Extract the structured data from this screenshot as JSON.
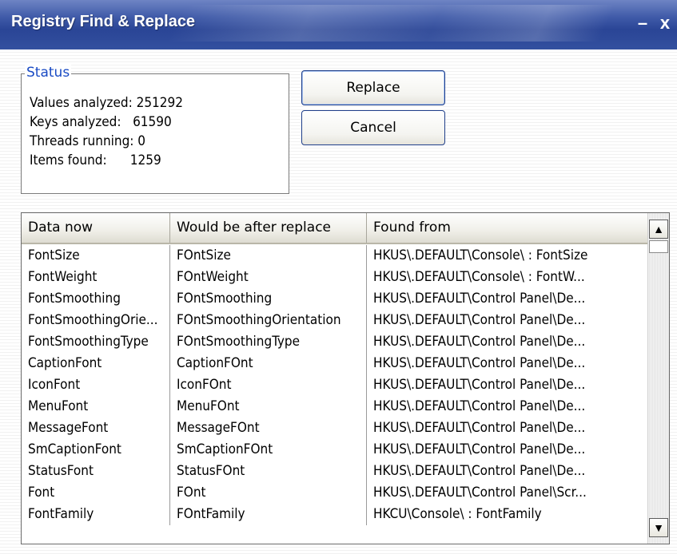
{
  "window": {
    "title": "Registry Find & Replace",
    "minimize_glyph": "–",
    "close_glyph": "x"
  },
  "status": {
    "legend": "Status",
    "values_analyzed": "Values analyzed: 251292",
    "keys_analyzed": "Keys analyzed:   61590",
    "threads_running": "Threads running: 0",
    "items_found": "Items found:      1259"
  },
  "buttons": {
    "replace": "Replace",
    "cancel": "Cancel"
  },
  "table": {
    "columns": [
      "Data now",
      "Would be after replace",
      "Found from"
    ],
    "rows": [
      [
        "FontSize",
        "FOntSize",
        "HKUS\\.DEFAULT\\Console\\ : FontSize"
      ],
      [
        "FontWeight",
        "FOntWeight",
        "HKUS\\.DEFAULT\\Console\\ : FontW..."
      ],
      [
        "FontSmoothing",
        "FOntSmoothing",
        "HKUS\\.DEFAULT\\Control Panel\\De..."
      ],
      [
        "FontSmoothingOrie...",
        "FOntSmoothingOrientation",
        "HKUS\\.DEFAULT\\Control Panel\\De..."
      ],
      [
        "FontSmoothingType",
        "FOntSmoothingType",
        "HKUS\\.DEFAULT\\Control Panel\\De..."
      ],
      [
        "CaptionFont",
        "CaptionFOnt",
        "HKUS\\.DEFAULT\\Control Panel\\De..."
      ],
      [
        "IconFont",
        "IconFOnt",
        "HKUS\\.DEFAULT\\Control Panel\\De..."
      ],
      [
        "MenuFont",
        "MenuFOnt",
        "HKUS\\.DEFAULT\\Control Panel\\De..."
      ],
      [
        "MessageFont",
        "MessageFOnt",
        "HKUS\\.DEFAULT\\Control Panel\\De..."
      ],
      [
        "SmCaptionFont",
        "SmCaptionFOnt",
        "HKUS\\.DEFAULT\\Control Panel\\De..."
      ],
      [
        "StatusFont",
        "StatusFOnt",
        "HKUS\\.DEFAULT\\Control Panel\\De..."
      ],
      [
        "Font",
        "FOnt",
        "HKUS\\.DEFAULT\\Control Panel\\Scr..."
      ],
      [
        "FontFamily",
        "FOntFamily",
        "HKCU\\Console\\ : FontFamily"
      ]
    ]
  },
  "scrollbar": {
    "up_icon": "up-arrow-icon",
    "down_icon": "down-arrow-icon"
  }
}
